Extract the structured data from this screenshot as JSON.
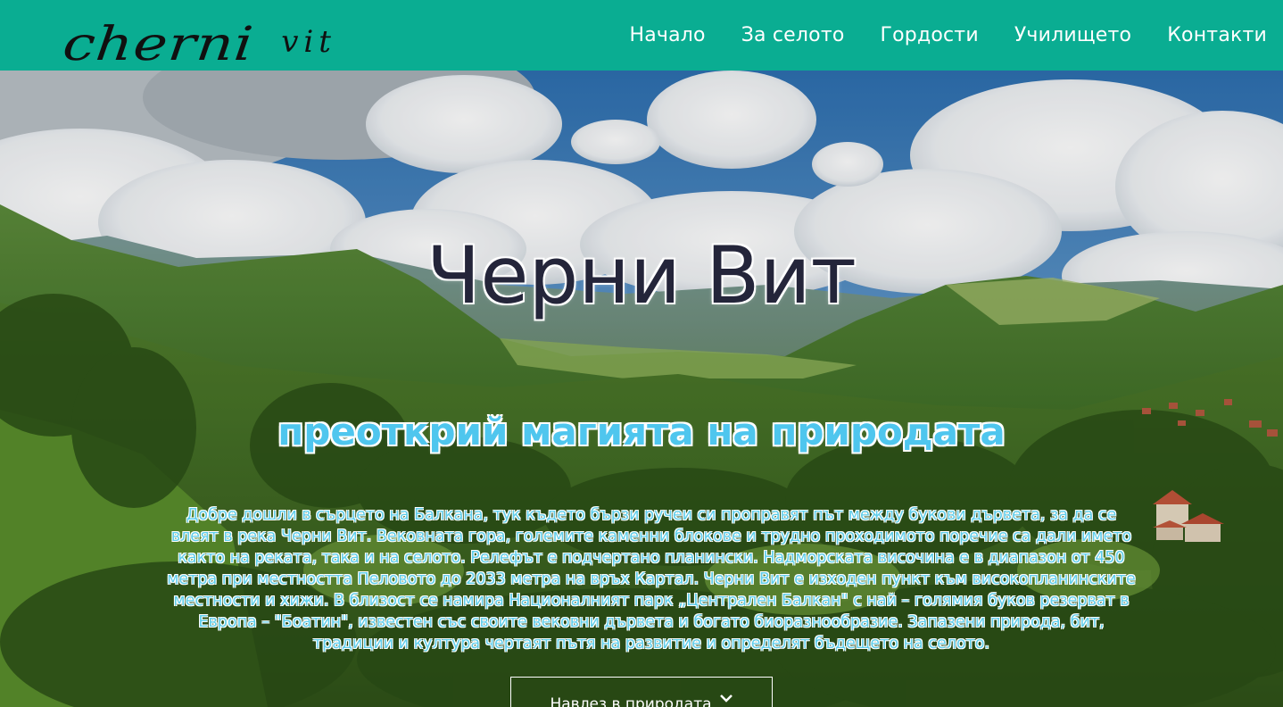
{
  "header": {
    "logo_main": "cherni",
    "logo_sub": "vit",
    "nav": [
      {
        "label": "Начало"
      },
      {
        "label": "За селото"
      },
      {
        "label": "Гордости"
      },
      {
        "label": "Училището"
      },
      {
        "label": "Контакти"
      }
    ]
  },
  "hero": {
    "title": "Черни Вит",
    "subtitle": "преоткрий магията на природата",
    "paragraph": "Добре дошли в сърцето на Балкана, тук където бързи ручеи си проправят път между букови дървета, за да се влеят в река Черни Вит. Вековната гора, големите каменни блокове и трудно проходимото поречие са дали името както на реката, така и на селото. Релефът е подчертано планински. Надморската височина е в диапазон от 450 метра при местността Пеловото до 2033 метра на връх Картал. Черни Вит е изходен пункт към високопланинските местности и хижи. В близост се намира Националният парк „Централен Балкан\" с най – голямия буков резерват в Европа – \"Боатин\", известен със своите вековни дървета и богато биоразнообразие. Запазени природа, бит, традиции и култура чертаят пътя на развитие и определят бъдещето на селото.",
    "cta_label": "Навлез в природата",
    "cta_icon": "chevron-down-icon"
  },
  "colors": {
    "header_bg": "#0aad92",
    "title": "#24253a",
    "subtitle": "#4fc6ee",
    "paragraph": "#5fcdea",
    "nav_text": "#ffffff"
  }
}
